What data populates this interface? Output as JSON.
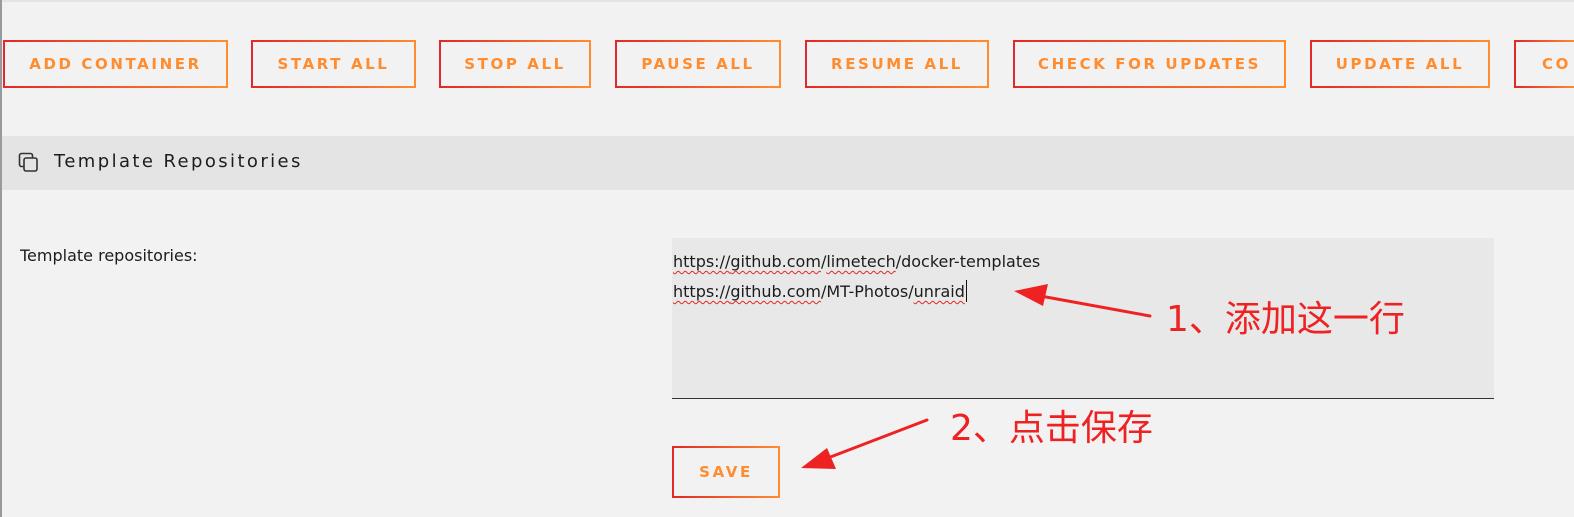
{
  "toolbar": {
    "buttons": [
      {
        "label": "ADD CONTAINER"
      },
      {
        "label": "START ALL"
      },
      {
        "label": "STOP ALL"
      },
      {
        "label": "PAUSE ALL"
      },
      {
        "label": "RESUME ALL"
      },
      {
        "label": "CHECK FOR UPDATES"
      },
      {
        "label": "UPDATE ALL"
      },
      {
        "label": "CO"
      }
    ]
  },
  "section": {
    "title": "Template Repositories",
    "icon": "copy-icon"
  },
  "form": {
    "label": "Template repositories:",
    "repos": {
      "line1": {
        "a": "https://",
        "b": "github.com",
        "c": "/",
        "d": "limetech",
        "e": "/docker-templates"
      },
      "line2": {
        "a": "https://",
        "b": "github.com",
        "c": "/MT-Photos/",
        "d": "unraid"
      }
    },
    "save_label": "SAVE"
  },
  "annotations": {
    "step1": "1、添加这一行",
    "step2": "2、点击保存"
  },
  "colors": {
    "accent_orange": "#ff8c2f",
    "accent_red": "#e22828",
    "annotation_red": "#ee2222",
    "background": "#f2f2f2",
    "header_bg": "#e4e4e4"
  }
}
